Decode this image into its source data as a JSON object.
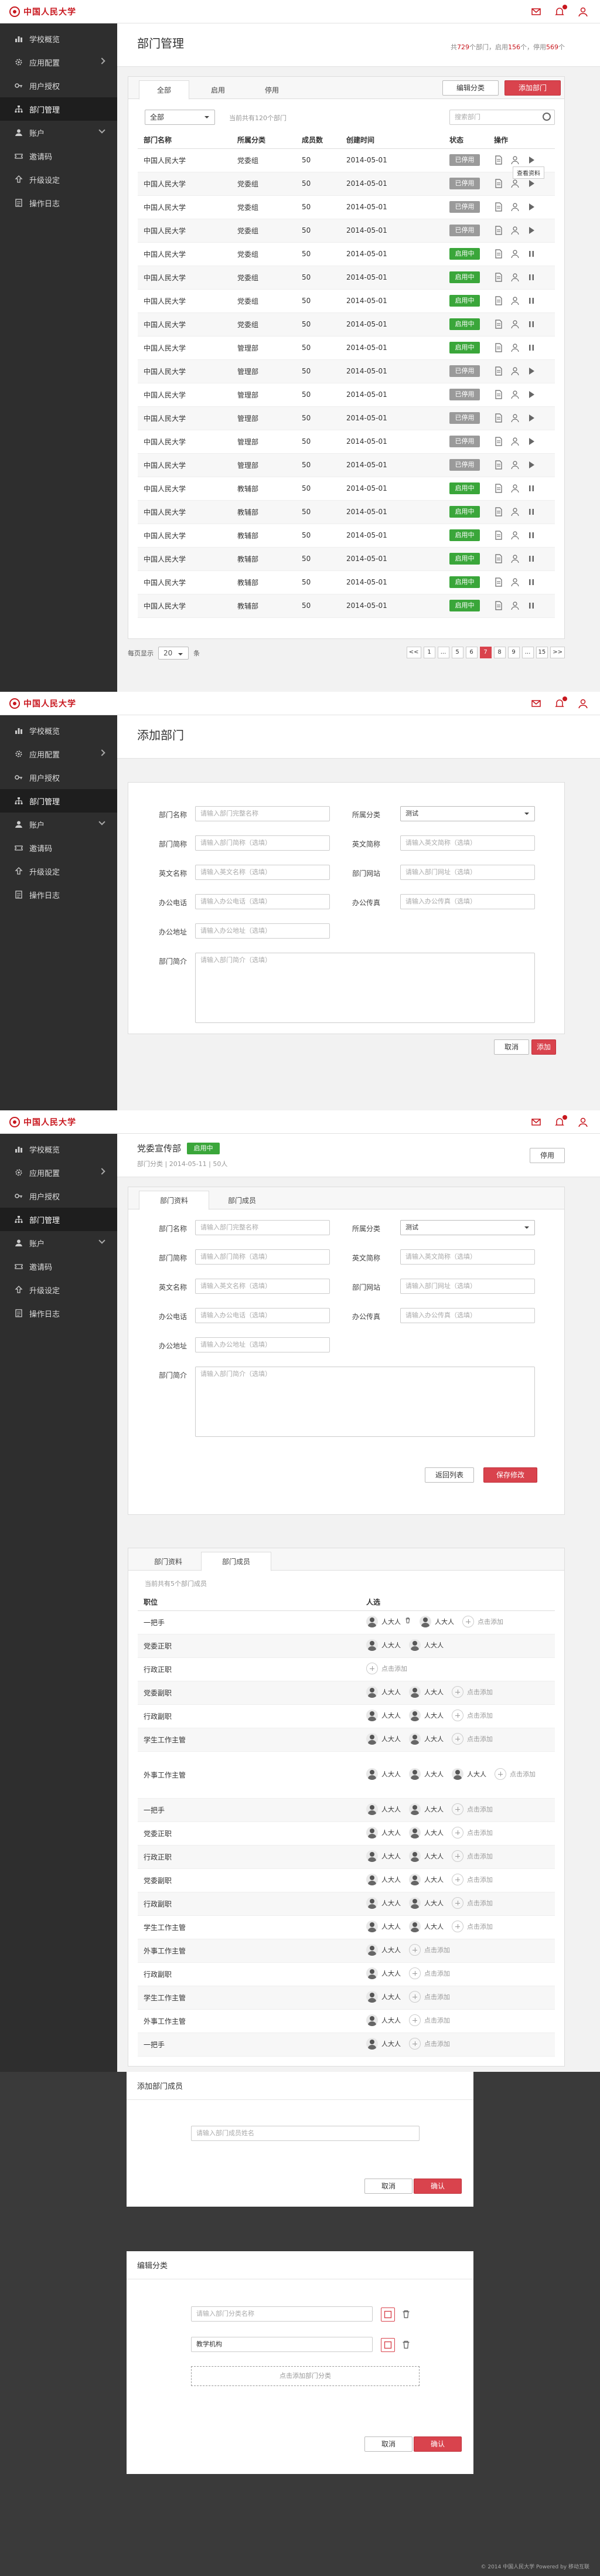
{
  "brand": {
    "name": "中国人民大学"
  },
  "sidebar": {
    "items": [
      {
        "label": "学校概览",
        "icon": "chart-icon"
      },
      {
        "label": "应用配置",
        "icon": "gear-icon",
        "arrow": "right"
      },
      {
        "label": "用户授权",
        "icon": "key-icon"
      },
      {
        "label": "部门管理",
        "icon": "org-icon",
        "active": true
      },
      {
        "label": "账户",
        "icon": "user-icon",
        "arrow": "down"
      },
      {
        "label": "邀请码",
        "icon": "ticket-icon"
      },
      {
        "label": "升级设定",
        "icon": "upgrade-icon"
      },
      {
        "label": "操作日志",
        "icon": "log-icon"
      }
    ]
  },
  "s1": {
    "title": "部门管理",
    "stat": {
      "p1": "共",
      "n1": "729",
      "p2": "个部门，启用",
      "n2": "156",
      "p3": "个，停用",
      "n3": "569",
      "p4": "个"
    },
    "tabs": [
      "全部",
      "启用",
      "停用"
    ],
    "btn_edit": "编辑分类",
    "btn_add": "添加部门",
    "filter": "全部",
    "count_text": "当前共有120个部门",
    "search": "搜索部门",
    "cols": [
      "部门名称",
      "所属分类",
      "成员数",
      "创建时间",
      "状态",
      "操作"
    ],
    "tooltip": "查看资料",
    "rows": [
      [
        "中国人民大学",
        "党委组",
        "50",
        "2014-05-01",
        "已停用"
      ],
      [
        "中国人民大学",
        "党委组",
        "50",
        "2014-05-01",
        "已停用"
      ],
      [
        "中国人民大学",
        "党委组",
        "50",
        "2014-05-01",
        "已停用"
      ],
      [
        "中国人民大学",
        "党委组",
        "50",
        "2014-05-01",
        "已停用"
      ],
      [
        "中国人民大学",
        "党委组",
        "50",
        "2014-05-01",
        "启用中"
      ],
      [
        "中国人民大学",
        "党委组",
        "50",
        "2014-05-01",
        "启用中"
      ],
      [
        "中国人民大学",
        "党委组",
        "50",
        "2014-05-01",
        "启用中"
      ],
      [
        "中国人民大学",
        "党委组",
        "50",
        "2014-05-01",
        "启用中"
      ],
      [
        "中国人民大学",
        "管理部",
        "50",
        "2014-05-01",
        "启用中"
      ],
      [
        "中国人民大学",
        "管理部",
        "50",
        "2014-05-01",
        "已停用"
      ],
      [
        "中国人民大学",
        "管理部",
        "50",
        "2014-05-01",
        "已停用"
      ],
      [
        "中国人民大学",
        "管理部",
        "50",
        "2014-05-01",
        "已停用"
      ],
      [
        "中国人民大学",
        "管理部",
        "50",
        "2014-05-01",
        "已停用"
      ],
      [
        "中国人民大学",
        "管理部",
        "50",
        "2014-05-01",
        "已停用"
      ],
      [
        "中国人民大学",
        "教辅部",
        "50",
        "2014-05-01",
        "启用中"
      ],
      [
        "中国人民大学",
        "教辅部",
        "50",
        "2014-05-01",
        "启用中"
      ],
      [
        "中国人民大学",
        "教辅部",
        "50",
        "2014-05-01",
        "启用中"
      ],
      [
        "中国人民大学",
        "教辅部",
        "50",
        "2014-05-01",
        "启用中"
      ],
      [
        "中国人民大学",
        "教辅部",
        "50",
        "2014-05-01",
        "启用中"
      ],
      [
        "中国人民大学",
        "教辅部",
        "50",
        "2014-05-01",
        "启用中"
      ]
    ],
    "perpage_label": "每页显示",
    "perpage": "20",
    "perpage_unit": "条",
    "pages": [
      "<<",
      "1",
      "...",
      "5",
      "6",
      "7",
      "8",
      "9",
      "...",
      "15",
      ">>"
    ],
    "current_page": "7",
    "status_colors": {
      "已停用": "#9a9a9a",
      "启用中": "#3aa63a"
    }
  },
  "form": {
    "name_label": "部门名称",
    "name_ph": "请输入部门完整名称",
    "cat_label": "所属分类",
    "cat_val": "测试",
    "short_label": "部门简称",
    "short_ph": "请输入部门简称（选填）",
    "en_label": "英文名称",
    "en_ph": "请输入英文名称（选填）",
    "enshort_label": "英文简称",
    "enshort_ph": "请输入英文简称（选填）",
    "web_label": "部门网站",
    "web_ph": "请输入部门网址（选填）",
    "tel_label": "办公电话",
    "tel_ph": "请输入办公电话（选填）",
    "fax_label": "办公传真",
    "fax_ph": "请输入办公传真（选填）",
    "addr_label": "办公地址",
    "addr_ph": "请输入办公地址（选填）",
    "intro_label": "部门简介",
    "intro_ph": "请输入部门简介（选填）"
  },
  "s2": {
    "title": "添加部门",
    "cancel": "取消",
    "add": "添加"
  },
  "s3": {
    "name": "党委宣传部",
    "status": "启用中",
    "meta": "部门分类 | 2014-05-11 | 50人",
    "btn_stop": "停用",
    "tabs": [
      "部门资料",
      "部门成员"
    ],
    "back": "返回列表",
    "save": "保存修改"
  },
  "s4": {
    "tabs": [
      "部门资料",
      "部门成员"
    ],
    "info": "当前共有5个部门成员",
    "cols": [
      "职位",
      "人选"
    ],
    "member_name": "人大人",
    "add_text": "点击添加",
    "rows": [
      {
        "pos": "一把手",
        "m": 2,
        "add": true,
        "trash": true
      },
      {
        "pos": "党委正职",
        "m": 2,
        "add": false
      },
      {
        "pos": "行政正职",
        "m": 0,
        "add": true
      },
      {
        "pos": "党委副职",
        "m": 2,
        "add": true
      },
      {
        "pos": "行政副职",
        "m": 2,
        "add": true
      },
      {
        "pos": "学生工作主管",
        "m": 2,
        "add": true
      },
      {
        "pos": "外事工作主管",
        "m": 3,
        "add": true,
        "tall": true
      },
      {
        "pos": "一把手",
        "m": 2,
        "add": true
      },
      {
        "pos": "党委正职",
        "m": 2,
        "add": true
      },
      {
        "pos": "行政正职",
        "m": 2,
        "add": true
      },
      {
        "pos": "党委副职",
        "m": 2,
        "add": true
      },
      {
        "pos": "行政副职",
        "m": 2,
        "add": true
      },
      {
        "pos": "学生工作主管",
        "m": 2,
        "add": true
      },
      {
        "pos": "外事工作主管",
        "m": 1,
        "add": true
      },
      {
        "pos": "行政副职",
        "m": 1,
        "add": true
      },
      {
        "pos": "学生工作主管",
        "m": 1,
        "add": true
      },
      {
        "pos": "外事工作主管",
        "m": 1,
        "add": true
      },
      {
        "pos": "一把手",
        "m": 1,
        "add": true
      }
    ]
  },
  "m1": {
    "title": "添加部门成员",
    "ph": "请输入部门成员姓名",
    "cancel": "取消",
    "ok": "确认"
  },
  "m2": {
    "title": "编辑分类",
    "ph": "请输入部门分类名称",
    "item2": "教学机构",
    "add_text": "点击添加部门分类",
    "cancel": "取消",
    "ok": "确认"
  },
  "footer": "© 2014 中国人民大学 Powered by 移动互联"
}
